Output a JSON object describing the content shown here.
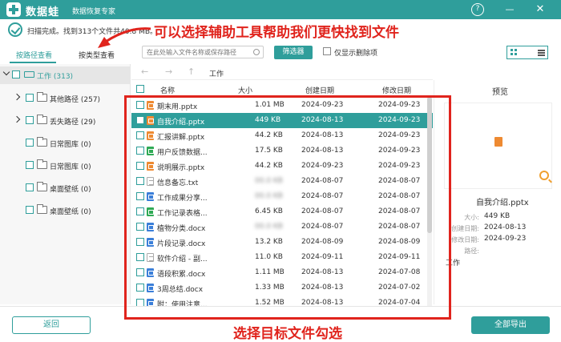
{
  "titlebar": {
    "app_name": "数据蛙",
    "subtitle": "数据恢复专家",
    "help": "?",
    "minimize": "—",
    "close": "✕"
  },
  "status": {
    "text": "扫描完成。找到313个文件共40.8 MB。"
  },
  "annotations": {
    "top": "可以选择辅助工具帮助我们更快找到文件",
    "bottom": "选择目标文件勾选"
  },
  "tabs": {
    "by_path": "按路径查看",
    "by_type": "按类型查看"
  },
  "search": {
    "placeholder": "在此处输入文件名称或保存路径"
  },
  "toolbar": {
    "filter": "筛选器",
    "deleted_only": "仅显示删除项"
  },
  "tree": [
    {
      "label": "工作 (313)",
      "expanded": true,
      "selected": true
    },
    {
      "label": "其他路径 (257)"
    },
    {
      "label": "丢失路径 (29)"
    },
    {
      "label": "日常图库 (0)"
    },
    {
      "label": "日常图库 (0)"
    },
    {
      "label": "桌面壁纸 (0)"
    },
    {
      "label": "桌面壁纸 (0)"
    }
  ],
  "nav": {
    "back": "←",
    "forward": "→",
    "up": "↑",
    "crumb": "工作"
  },
  "table": {
    "headers": {
      "name": "名称",
      "size": "大小",
      "created": "创建日期",
      "modified": "修改日期"
    },
    "rows": [
      {
        "name": "期末用.pptx",
        "size": "1.01 MB",
        "created": "2024-09-23",
        "modified": "2024-09-23",
        "type": "ppt"
      },
      {
        "name": "自我介绍.pptx",
        "size": "449 KB",
        "created": "2024-08-13",
        "modified": "2024-09-23",
        "type": "ppt",
        "selected": true
      },
      {
        "name": "汇报讲解.pptx",
        "size": "44.2 KB",
        "created": "2024-08-13",
        "modified": "2024-09-23",
        "type": "ppt"
      },
      {
        "name": "用户反馈数据...",
        "size": "17.5 KB",
        "created": "2024-08-13",
        "modified": "2024-09-23",
        "type": "xls"
      },
      {
        "name": "说明展示.pptx",
        "size": "44.2 KB",
        "created": "2024-09-23",
        "modified": "2024-09-23",
        "type": "ppt"
      },
      {
        "name": "信息备忘.txt",
        "size": "",
        "created": "2024-08-07",
        "modified": "2024-08-07",
        "type": "txt",
        "size_blurred": true
      },
      {
        "name": "工作成果分享...",
        "size": "",
        "created": "2024-08-07",
        "modified": "2024-08-07",
        "type": "doc",
        "size_blurred": true
      },
      {
        "name": "工作记录表格...",
        "size": "6.45 KB",
        "created": "2024-08-07",
        "modified": "2024-08-07",
        "type": "xls"
      },
      {
        "name": "植物分类.docx",
        "size": "",
        "created": "2024-08-07",
        "modified": "2024-08-07",
        "type": "doc",
        "size_blurred": true
      },
      {
        "name": "片段记录.docx",
        "size": "13.2 KB",
        "created": "2024-08-09",
        "modified": "2024-08-09",
        "type": "doc"
      },
      {
        "name": "软件介绍 - 副...",
        "size": "11.0 KB",
        "created": "2024-09-11",
        "modified": "2024-09-11",
        "type": "txt"
      },
      {
        "name": "语段积累.docx",
        "size": "1.11 MB",
        "created": "2024-08-13",
        "modified": "2024-07-08",
        "type": "doc"
      },
      {
        "name": "3周总结.docx",
        "size": "1.33 MB",
        "created": "2024-08-13",
        "modified": "2024-07-02",
        "type": "doc"
      },
      {
        "name": "附：使用注意...",
        "size": "1.52 MB",
        "created": "2024-08-13",
        "modified": "2024-07-04",
        "type": "doc"
      }
    ]
  },
  "preview": {
    "title": "预览",
    "file_name": "自我介绍.pptx",
    "size_label": "大小:",
    "size_value": "449 KB",
    "created_label": "创建日期:",
    "created_value": "2024-08-13",
    "modified_label": "修改日期:",
    "modified_value": "2024-09-23",
    "path_label": "路径:",
    "path_value": "工作"
  },
  "bottom": {
    "back": "返回",
    "export": "全部导出"
  },
  "colors": {
    "accent": "#2f9e9b",
    "annotation": "#e0241d",
    "ppt": "#ee8a32",
    "xls": "#2faa55",
    "doc": "#3b7fd9"
  }
}
